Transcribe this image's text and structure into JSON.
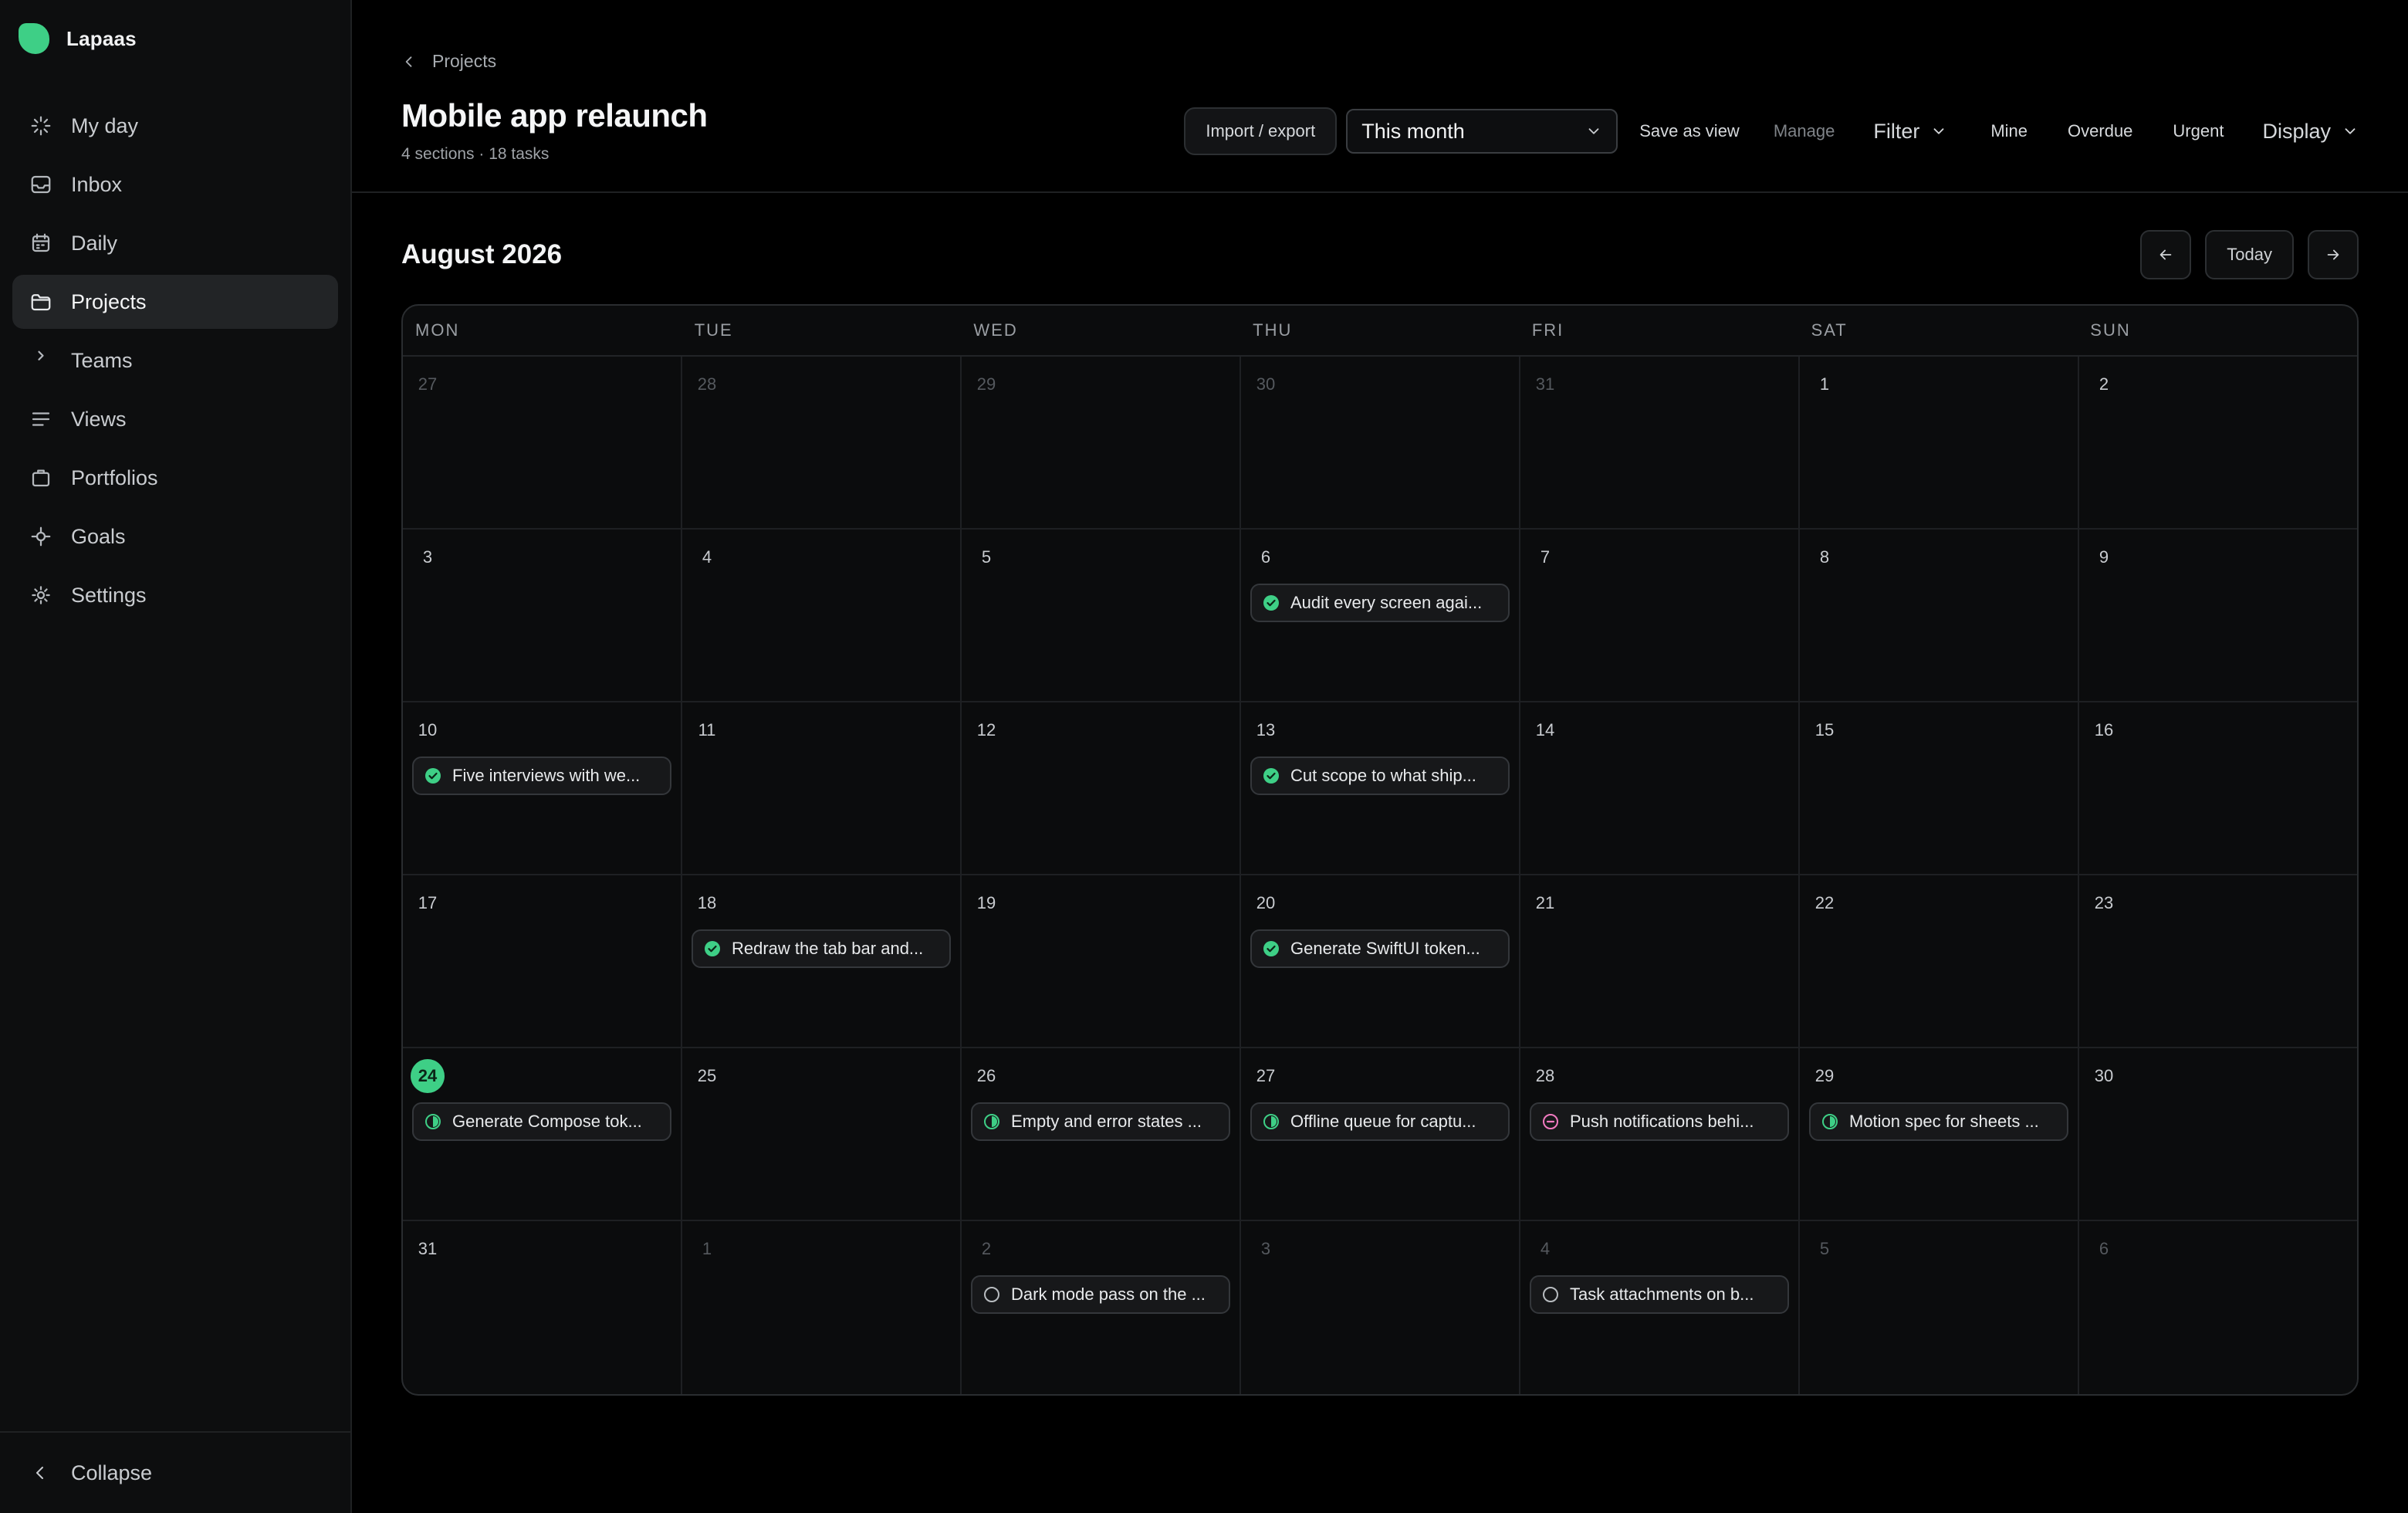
{
  "app": {
    "name": "Lapaas",
    "accent": "#3ecf86"
  },
  "sidebar": {
    "items": [
      {
        "label": "My day",
        "icon": "sparkle-icon",
        "active": false
      },
      {
        "label": "Inbox",
        "icon": "inbox-icon",
        "active": false
      },
      {
        "label": "Daily",
        "icon": "calendar-icon",
        "active": false
      },
      {
        "label": "Projects",
        "icon": "folder-icon",
        "active": true
      },
      {
        "label": "Teams",
        "icon": "chevron-right-icon",
        "active": false
      },
      {
        "label": "Views",
        "icon": "list-icon",
        "active": false
      },
      {
        "label": "Portfolios",
        "icon": "briefcase-icon",
        "active": false
      },
      {
        "label": "Goals",
        "icon": "target-icon",
        "active": false
      },
      {
        "label": "Settings",
        "icon": "gear-icon",
        "active": false
      }
    ],
    "collapse_label": "Collapse"
  },
  "header": {
    "breadcrumb": "Projects",
    "title": "Mobile app relaunch",
    "meta": "4 sections · 18 tasks",
    "toolbar": {
      "import_export": "Import / export",
      "range": "This month",
      "save_view": "Save as view",
      "manage": "Manage",
      "filter": "Filter",
      "mine": "Mine",
      "overdue": "Overdue",
      "urgent": "Urgent",
      "display": "Display"
    }
  },
  "calendar": {
    "month_label": "August 2026",
    "today_label": "Today",
    "weekdays": [
      "MON",
      "TUE",
      "WED",
      "THU",
      "FRI",
      "SAT",
      "SUN"
    ],
    "days": [
      {
        "n": "27",
        "other": true
      },
      {
        "n": "28",
        "other": true
      },
      {
        "n": "29",
        "other": true
      },
      {
        "n": "30",
        "other": true
      },
      {
        "n": "31",
        "other": true
      },
      {
        "n": "1"
      },
      {
        "n": "2"
      },
      {
        "n": "3"
      },
      {
        "n": "4"
      },
      {
        "n": "5"
      },
      {
        "n": "6",
        "task": {
          "label": "Audit every screen agai...",
          "status": "done"
        }
      },
      {
        "n": "7"
      },
      {
        "n": "8"
      },
      {
        "n": "9"
      },
      {
        "n": "10",
        "task": {
          "label": "Five interviews with we...",
          "status": "done"
        }
      },
      {
        "n": "11"
      },
      {
        "n": "12"
      },
      {
        "n": "13",
        "task": {
          "label": "Cut scope to what ship...",
          "status": "done"
        }
      },
      {
        "n": "14"
      },
      {
        "n": "15"
      },
      {
        "n": "16"
      },
      {
        "n": "17"
      },
      {
        "n": "18",
        "task": {
          "label": "Redraw the tab bar and...",
          "status": "done"
        }
      },
      {
        "n": "19"
      },
      {
        "n": "20",
        "task": {
          "label": "Generate SwiftUI token...",
          "status": "done"
        }
      },
      {
        "n": "21"
      },
      {
        "n": "22"
      },
      {
        "n": "23"
      },
      {
        "n": "24",
        "today": true,
        "task": {
          "label": "Generate Compose tok...",
          "status": "in-progress"
        }
      },
      {
        "n": "25"
      },
      {
        "n": "26",
        "task": {
          "label": "Empty and error states ...",
          "status": "in-progress"
        }
      },
      {
        "n": "27",
        "task": {
          "label": "Offline queue for captu...",
          "status": "in-progress"
        }
      },
      {
        "n": "28",
        "task": {
          "label": "Push notifications behi...",
          "status": "blocked"
        }
      },
      {
        "n": "29",
        "task": {
          "label": "Motion spec for sheets ...",
          "status": "in-progress"
        }
      },
      {
        "n": "30"
      },
      {
        "n": "31"
      },
      {
        "n": "1",
        "other": true
      },
      {
        "n": "2",
        "other": true,
        "task": {
          "label": "Dark mode pass on the ...",
          "status": "todo"
        }
      },
      {
        "n": "3",
        "other": true
      },
      {
        "n": "4",
        "other": true,
        "task": {
          "label": "Task attachments on b...",
          "status": "todo"
        }
      },
      {
        "n": "5",
        "other": true
      },
      {
        "n": "6",
        "other": true
      }
    ]
  },
  "colors": {
    "done": "#3ecf86",
    "in_progress": "#3ecf86",
    "blocked": "#f07ac0",
    "todo": "#b8bcc0"
  }
}
